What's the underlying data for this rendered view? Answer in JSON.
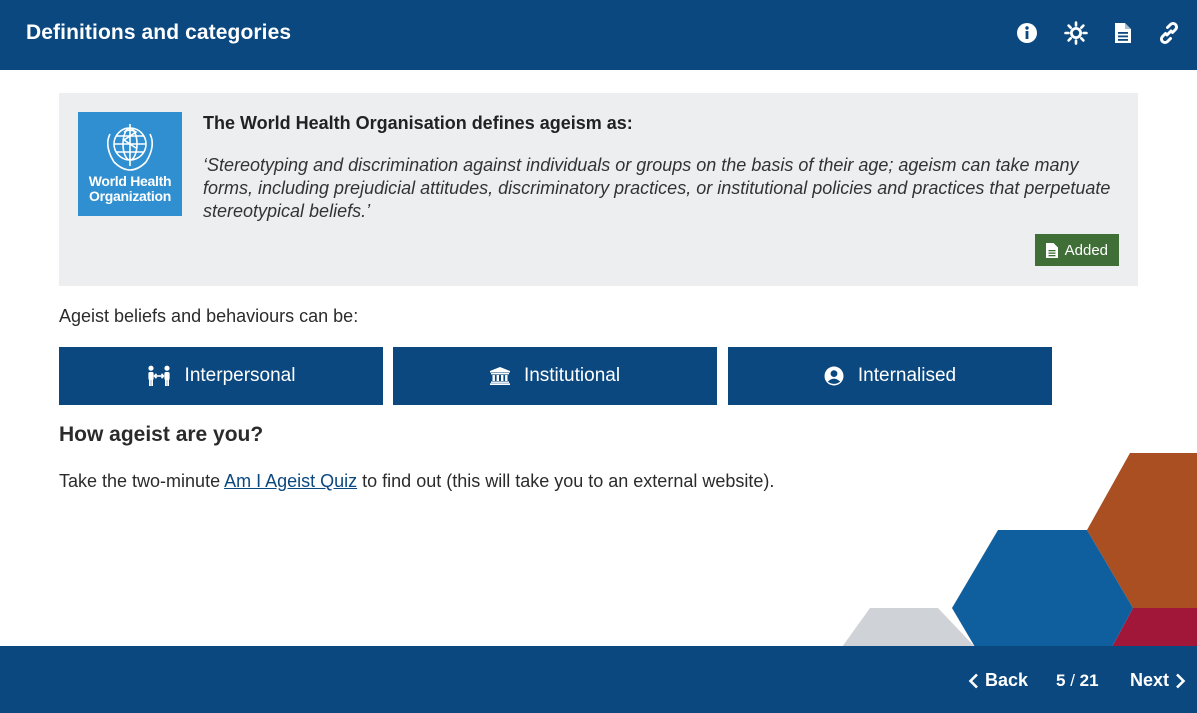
{
  "header": {
    "title": "Definitions and categories",
    "tools": [
      {
        "name": "info-button",
        "icon": "info-icon"
      },
      {
        "name": "theme-button",
        "icon": "sun-icon"
      },
      {
        "name": "resources-button",
        "icon": "document-icon"
      },
      {
        "name": "links-button",
        "icon": "link-icon"
      }
    ]
  },
  "callout": {
    "logo_text": "World Health Organization",
    "heading": "The World Health Organisation defines ageism as:",
    "quote": "‘Stereotyping and discrimination against individuals or groups on the basis of their age; ageism can take many forms, including prejudicial attitudes, discriminatory practices, or institutional policies and practices that perpetuate stereotypical beliefs.’",
    "added_label": "Added"
  },
  "intro": "Ageist beliefs and behaviours can be:",
  "categories": [
    {
      "label": "Interpersonal",
      "icon": "people-icon"
    },
    {
      "label": "Institutional",
      "icon": "institution-icon"
    },
    {
      "label": "Internalised",
      "icon": "user-circle-icon"
    }
  ],
  "quiz": {
    "heading": "How ageist are you?",
    "text_before": "Take the two-minute ",
    "link_text": "Am I Ageist Quiz",
    "text_after": " to find out (this will take you to an external website)."
  },
  "footer": {
    "back_label": "Back",
    "next_label": "Next",
    "page_current": "5",
    "page_separator": " / ",
    "page_total": "21"
  },
  "colors": {
    "brand_blue": "#0b487f",
    "panel_grey": "#edeef0",
    "added_green": "#3f6e37",
    "who_blue": "#2f8fd0",
    "hex_orange": "#a94f22",
    "hex_blue": "#0f5f9e",
    "hex_grey": "#cfd2d6",
    "hex_red": "#a0173a"
  }
}
